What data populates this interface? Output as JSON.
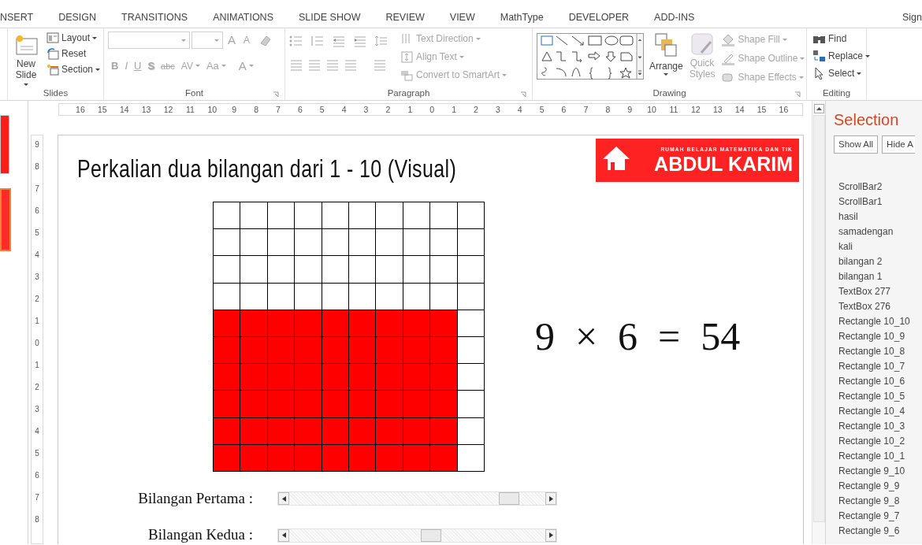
{
  "tabs": [
    "NSERT",
    "DESIGN",
    "TRANSITIONS",
    "ANIMATIONS",
    "SLIDE SHOW",
    "REVIEW",
    "VIEW",
    "MathType",
    "DEVELOPER",
    "ADD-INS"
  ],
  "account": "Sign",
  "slides_group": {
    "label": "Slides",
    "new_slide": "New Slide",
    "items": [
      {
        "label": "Layout",
        "dropdown": true
      },
      {
        "label": "Reset",
        "dropdown": false
      },
      {
        "label": "Section",
        "dropdown": true
      }
    ]
  },
  "font_group": {
    "label": "Font",
    "disabled": true,
    "size_buttons": [
      "A",
      "A"
    ],
    "buttons": [
      {
        "kind": "bold",
        "text": "B",
        "dropdown": false
      },
      {
        "kind": "italic",
        "text": "I",
        "dropdown": false
      },
      {
        "kind": "underline",
        "text": "U",
        "dropdown": false
      },
      {
        "kind": "shadow",
        "text": "S",
        "dropdown": false
      },
      {
        "kind": "strike",
        "text": "abc",
        "dropdown": false
      },
      {
        "kind": "spacing",
        "text": "AV",
        "dropdown": true
      },
      {
        "kind": "case",
        "text": "Aa",
        "dropdown": true
      },
      {
        "kind": "color",
        "text": "A",
        "dropdown": true
      }
    ]
  },
  "paragraph_group": {
    "label": "Paragraph",
    "items": [
      {
        "label": "Text Direction",
        "disabled": true
      },
      {
        "label": "Align Text",
        "disabled": true
      },
      {
        "label": "Convert to SmartArt",
        "disabled": true
      }
    ]
  },
  "drawing_group": {
    "label": "Drawing",
    "arrange": {
      "label": "Arrange",
      "disabled": false
    },
    "quick_styles": {
      "label": "Quick Styles",
      "disabled": true
    },
    "items": [
      {
        "label": "Shape Fill",
        "disabled": true
      },
      {
        "label": "Shape Outline",
        "disabled": true
      },
      {
        "label": "Shape Effects",
        "disabled": true
      }
    ]
  },
  "editing_group": {
    "label": "Editing",
    "items": [
      {
        "kind": "find",
        "label": "Find",
        "dropdown": false
      },
      {
        "kind": "replace",
        "label": "Replace",
        "dropdown": true
      },
      {
        "kind": "select",
        "label": "Select",
        "dropdown": true
      }
    ]
  },
  "thumbnails": [
    {
      "selected": false
    },
    {
      "selected": true
    }
  ],
  "ruler_h": [
    "16",
    "15",
    "14",
    "13",
    "12",
    "11",
    "10",
    "9",
    "8",
    "7",
    "6",
    "5",
    "4",
    "3",
    "2",
    "1",
    "0",
    "1",
    "2",
    "3",
    "4",
    "5",
    "6",
    "7",
    "8",
    "9",
    "10",
    "11",
    "12",
    "13",
    "14",
    "15",
    "16"
  ],
  "ruler_v": [
    "9",
    "8",
    "7",
    "6",
    "5",
    "4",
    "3",
    "2",
    "1",
    "0",
    "1",
    "2",
    "3",
    "4",
    "5",
    "6",
    "7",
    "8"
  ],
  "slide": {
    "title": "Perkalian dua bilangan dari 1 - 10 (Visual)",
    "logo": {
      "tagline": "RUMAH BELAJAR MATEMATIKA DAN TIK",
      "name": "ABDUL KARIM"
    },
    "grid_rows": [
      [
        false,
        false,
        false,
        false,
        false,
        false,
        false,
        false,
        false,
        false
      ],
      [
        false,
        false,
        false,
        false,
        false,
        false,
        false,
        false,
        false,
        false
      ],
      [
        false,
        false,
        false,
        false,
        false,
        false,
        false,
        false,
        false,
        false
      ],
      [
        false,
        false,
        false,
        false,
        false,
        false,
        false,
        false,
        false,
        false
      ],
      [
        true,
        true,
        true,
        true,
        true,
        true,
        true,
        true,
        true,
        false
      ],
      [
        true,
        true,
        true,
        true,
        true,
        true,
        true,
        true,
        true,
        false
      ],
      [
        true,
        true,
        true,
        true,
        true,
        true,
        true,
        true,
        true,
        false
      ],
      [
        true,
        true,
        true,
        true,
        true,
        true,
        true,
        true,
        true,
        false
      ],
      [
        true,
        true,
        true,
        true,
        true,
        true,
        true,
        true,
        true,
        false
      ],
      [
        true,
        true,
        true,
        true,
        true,
        true,
        true,
        true,
        true,
        false
      ]
    ],
    "equation": [
      "9",
      "×",
      "6",
      "=",
      "54"
    ],
    "sliders": [
      {
        "label": "Bilangan Pertama :",
        "level": 0.89
      },
      {
        "label": "Bilangan Kedua :",
        "level": 0.56
      }
    ]
  },
  "selection_pane": {
    "title": "Selection",
    "buttons": [
      "Show All",
      "Hide A"
    ],
    "items": [
      "ScrollBar2",
      "ScrollBar1",
      "hasil",
      "samadengan",
      "kali",
      "bilangan 2",
      "bilangan 1",
      "TextBox 277",
      "TextBox 276",
      "Rectangle 10_10",
      "Rectangle 10_9",
      "Rectangle 10_8",
      "Rectangle 10_7",
      "Rectangle 10_6",
      "Rectangle 10_5",
      "Rectangle 10_4",
      "Rectangle 10_3",
      "Rectangle 10_2",
      "Rectangle 10_1",
      "Rectangle 9_10",
      "Rectangle 9_9",
      "Rectangle 9_8",
      "Rectangle 9_7",
      "Rectangle 9_6"
    ]
  }
}
